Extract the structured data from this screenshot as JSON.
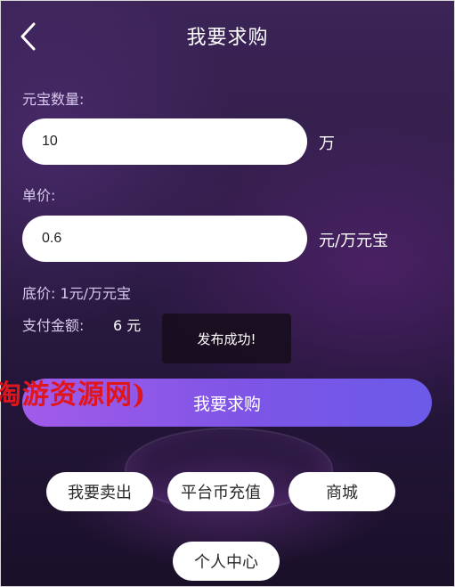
{
  "header": {
    "title": "我要求购"
  },
  "form": {
    "quantity_label": "元宝数量:",
    "quantity_value": "10",
    "quantity_unit": "万",
    "price_label": "单价:",
    "price_value": "0.6",
    "price_unit": "元/万元宝",
    "floor_price": "底价: 1元/万元宝",
    "amount_label": "支付金额:",
    "amount_value": "6 元"
  },
  "toast": {
    "text": "发布成功!"
  },
  "watermark": {
    "text": "淘游资源网)"
  },
  "buttons": {
    "submit": "我要求购",
    "sell": "我要卖出",
    "recharge": "平台币充值",
    "mall": "商城",
    "profile": "个人中心"
  }
}
